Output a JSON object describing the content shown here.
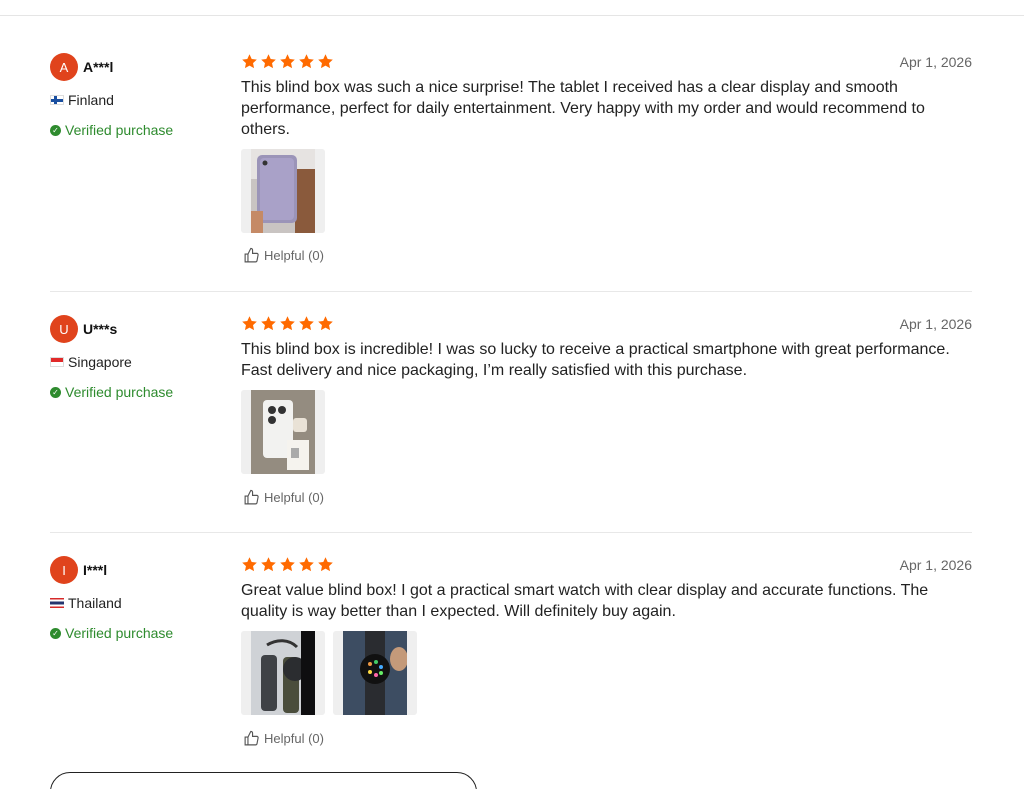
{
  "reviews": [
    {
      "avatar_letter": "A",
      "username": "A***l",
      "country": "Finland",
      "flag_icon": "finland-flag-icon",
      "verified": "Verified purchase",
      "rating": 5,
      "date": "Apr 1, 2026",
      "text": "This blind box was such a nice surprise! The tablet I received has a clear display and smooth performance, perfect for daily entertainment. Very happy with my order and would recommend to others.",
      "photos": [
        "tablet-photo"
      ],
      "helpful": "Helpful (0)"
    },
    {
      "avatar_letter": "U",
      "username": "U***s",
      "country": "Singapore",
      "flag_icon": "singapore-flag-icon",
      "verified": "Verified purchase",
      "rating": 5,
      "date": "Apr 1, 2026",
      "text": "This blind box is incredible! I was so lucky to receive a practical smartphone with great performance. Fast delivery and nice packaging, I’m really satisfied with this purchase.",
      "photos": [
        "smartphone-photo"
      ],
      "helpful": "Helpful (0)"
    },
    {
      "avatar_letter": "I",
      "username": "I***l",
      "country": "Thailand",
      "flag_icon": "thailand-flag-icon",
      "verified": "Verified purchase",
      "rating": 5,
      "date": "Apr 1, 2026",
      "text": "Great value blind box! I got a practical smart watch with clear display and accurate functions. The quality is way better than I expected. Will definitely buy again.",
      "photos": [
        "smartwatch-photo-1",
        "smartwatch-photo-2"
      ],
      "helpful": "Helpful (0)"
    }
  ],
  "colors": {
    "accent": "#e0431c",
    "star": "#ff6a00",
    "verified": "#2e8b2e"
  }
}
